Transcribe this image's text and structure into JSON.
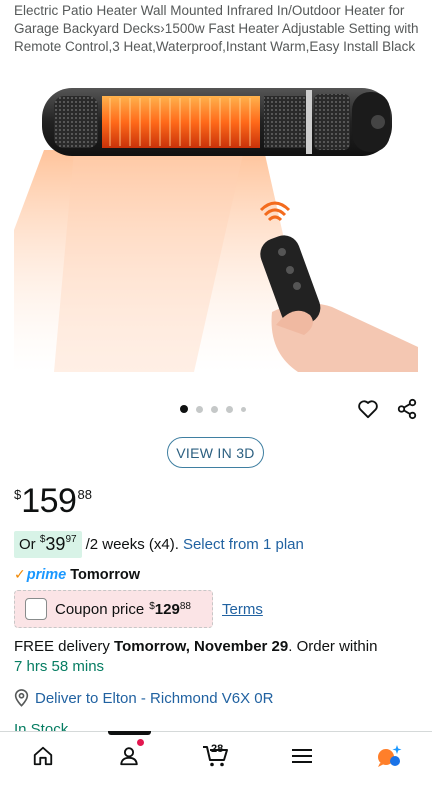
{
  "product": {
    "title": "Electric Patio Heater Wall Mounted Infrared In/Outdoor Heater for Garage Backyard Decks›1500w Fast Heater Adjustable Setting with Remote Control,3 Heat,Waterproof,Instant Warm,Easy Install Black"
  },
  "gallery": {
    "view_3d_label": "VIEW IN 3D",
    "image_count_dots": 5,
    "active_index": 0
  },
  "price": {
    "symbol": "$",
    "whole": "159",
    "fraction": "88"
  },
  "installment": {
    "prefix": "Or ",
    "symbol": "$",
    "whole": "39",
    "fraction": "97",
    "terms": "/2 weeks (x4).",
    "link": "Select from 1 plan"
  },
  "prime": {
    "check": "✓",
    "brand": "prime",
    "delivery_day": "Tomorrow"
  },
  "coupon": {
    "label": "Coupon price",
    "symbol": "$",
    "whole": "129",
    "fraction": "88",
    "terms_link": "Terms"
  },
  "delivery": {
    "prefix": "FREE delivery ",
    "date": "Tomorrow, November 29",
    "middle": ". Order within",
    "countdown": "7 hrs 58 mins"
  },
  "location": {
    "text": "Deliver to Elton - Richmond V6X 0R"
  },
  "stock": {
    "text": "In Stock"
  },
  "bottom_nav": {
    "cart_count": "28",
    "active_tab": "account"
  },
  "colors": {
    "link": "#2162a1",
    "green": "#067d62",
    "prime": "#1a98ff",
    "coupon_bg": "#fbe4e6",
    "installment_bg": "#d8f3e7"
  }
}
